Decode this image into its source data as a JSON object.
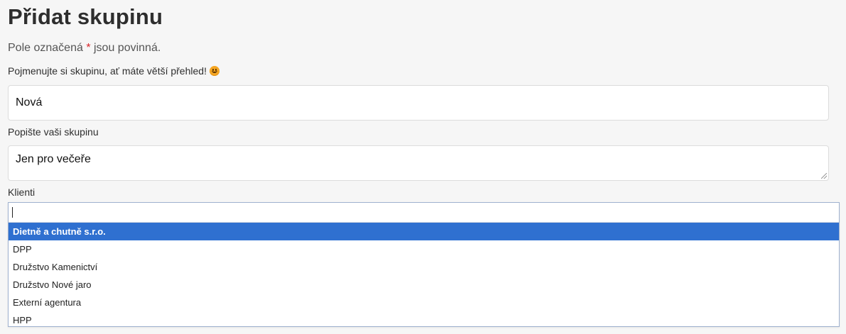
{
  "form": {
    "title": "Přidat skupinu",
    "required_note_prefix": "Pole označená ",
    "required_star": "*",
    "required_note_suffix": " jsou povinná.",
    "name_label": "Pojmenujte si skupinu, ať máte větší přehled!",
    "name_value": "Nová",
    "description_label": "Popište vaši skupinu",
    "description_value": "Jen pro večeře",
    "clients_label": "Klienti",
    "clients_search_value": "",
    "clients_options": [
      "Dietně a chutně s.r.o.",
      "DPP",
      "Družstvo Kamenictví",
      "Družstvo Nové jaro",
      "Externí agentura",
      "HPP"
    ],
    "highlighted_option": "Dietně a chutně s.r.o."
  },
  "icons": {
    "emoji": "smiling-face-icon"
  },
  "colors": {
    "highlight": "#2f70d0",
    "required_star": "#d9262b"
  }
}
